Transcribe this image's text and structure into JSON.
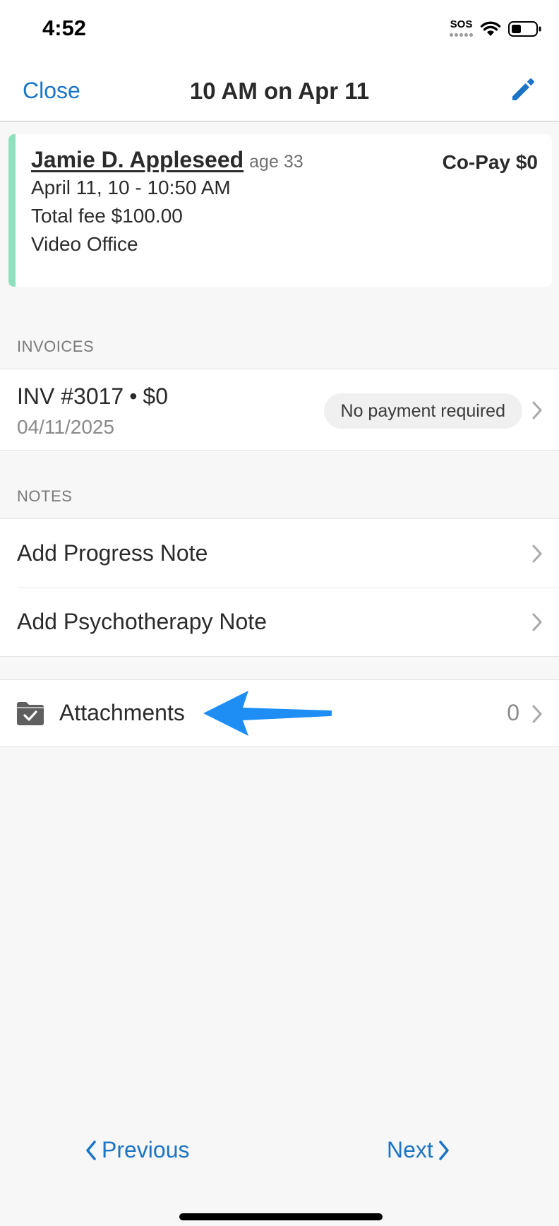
{
  "status_bar": {
    "time": "4:52",
    "sos": "SOS",
    "icons": [
      "sos-icon",
      "wifi-icon",
      "battery-icon"
    ]
  },
  "nav": {
    "close_label": "Close",
    "title": "10 AM on Apr 11",
    "edit_icon": "pencil-icon"
  },
  "appointment": {
    "client_name": "Jamie D. Appleseed",
    "age": "age 33",
    "copay": "Co-Pay $0",
    "time_range": "April 11, 10 - 10:50 AM",
    "total_fee": "Total fee $100.00",
    "location": "Video Office",
    "accent_color": "#8fe0bd"
  },
  "invoices": {
    "header": "INVOICES",
    "items": [
      {
        "number": "INV #3017",
        "separator": "•",
        "amount": "$0",
        "date": "04/11/2025",
        "status": "No payment required"
      }
    ]
  },
  "notes": {
    "header": "NOTES",
    "items": [
      {
        "label": "Add Progress Note"
      },
      {
        "label": "Add Psychotherapy Note"
      }
    ]
  },
  "attachments": {
    "label": "Attachments",
    "count": "0",
    "icon": "folder-check-icon",
    "annotation_color": "#1e8ef5"
  },
  "footer": {
    "previous_label": "Previous",
    "next_label": "Next"
  },
  "colors": {
    "accent": "#1b74c5",
    "background": "#f7f7f7"
  }
}
